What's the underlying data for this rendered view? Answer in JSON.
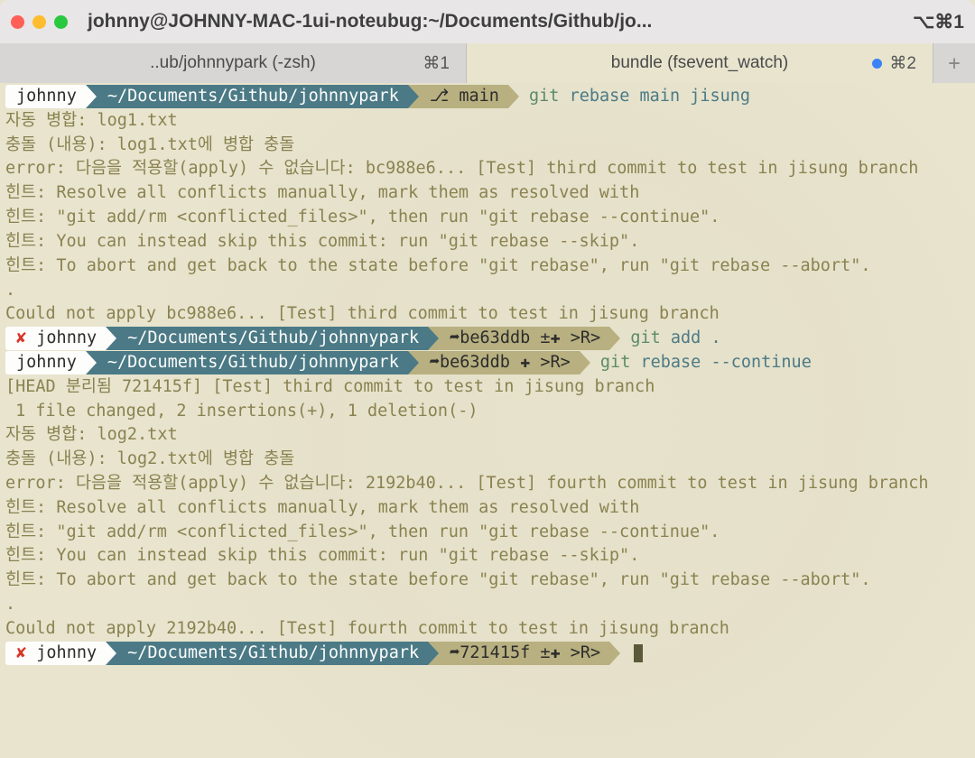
{
  "titlebar": {
    "title": "johnny@JOHNNY-MAC-1ui-noteubug:~/Documents/Github/jo...",
    "shortcut": "⌥⌘1"
  },
  "tabs": {
    "t1": {
      "label": "..ub/johnnypark (-zsh)",
      "shortcut": "⌘1"
    },
    "t2": {
      "label": "bundle (fsevent_watch)",
      "shortcut": "⌘2"
    },
    "add": "+"
  },
  "p1": {
    "user": "johnny",
    "path": "~/Documents/Github/johnnypark",
    "branch": "main",
    "cmd_hi": "git",
    "cmd_rest": " rebase main jisung"
  },
  "out1": {
    "l1": "자동 병합: log1.txt",
    "l2": "충돌 (내용): log1.txt에 병합 충돌",
    "l3": "error: 다음을 적용할(apply) 수 없습니다: bc988e6... [Test] third commit to test in jisung branch",
    "h1a": "힌트:",
    "h1b": " Resolve all conflicts manually, mark them as resolved with",
    "h2a": "힌트:",
    "h2b": " \"git add/rm <conflicted_files>\", then run \"git rebase --continue\".",
    "h3a": "힌트:",
    "h3b": " You can instead skip this commit: run \"git rebase --skip\".",
    "h4a": "힌트:",
    "h4b": " To abort and get back to the state before \"git rebase\", run \"git rebase --abort\".",
    "l8": "Could not apply bc988e6... [Test] third commit to test in jisung branch"
  },
  "p2": {
    "user": "johnny",
    "path": "~/Documents/Github/johnnypark",
    "state": "be63ddb ±✚ >R>",
    "cmd_hi": "git",
    "cmd_rest": " add ."
  },
  "p3": {
    "user": "johnny",
    "path": "~/Documents/Github/johnnypark",
    "state": "be63ddb ✚ >R>",
    "cmd_hi": "git",
    "cmd_rest": " rebase --continue"
  },
  "out2": {
    "l1": "[HEAD 분리됨 721415f] [Test] third commit to test in jisung branch",
    "l2": " 1 file changed, 2 insertions(+), 1 deletion(-)",
    "l3": "자동 병합: log2.txt",
    "l4": "충돌 (내용): log2.txt에 병합 충돌",
    "l5": "error: 다음을 적용할(apply) 수 없습니다: 2192b40... [Test] fourth commit to test in jisung branch",
    "h1a": "힌트:",
    "h1b": " Resolve all conflicts manually, mark them as resolved with",
    "h2a": "힌트:",
    "h2b": " \"git add/rm <conflicted_files>\", then run \"git rebase --continue\".",
    "h3a": "힌트:",
    "h3b": " You can instead skip this commit: run \"git rebase --skip\".",
    "h4a": "힌트:",
    "h4b": " To abort and get back to the state before \"git rebase\", run \"git rebase --abort\".",
    "l10": "Could not apply 2192b40... [Test] fourth commit to test in jisung branch"
  },
  "p4": {
    "user": "johnny",
    "path": "~/Documents/Github/johnnypark",
    "state": "721415f ±✚ >R>"
  }
}
